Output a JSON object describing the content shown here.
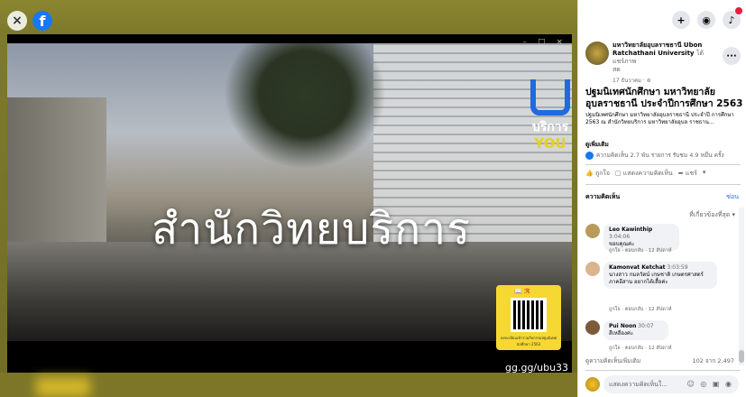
{
  "viewer": {
    "close_glyph": "×",
    "fb_glyph": "f",
    "window_controls": [
      "–",
      "□",
      "×"
    ],
    "caption": "สำนักวิทยบริการ",
    "brand": {
      "t1": "บริการ",
      "t2": "YOU"
    },
    "qr": {
      "tag": "📖 ℛ",
      "small_text": "ลงทะเบียนเข้าร่วมกิจกรรมปฐมนิเทศนักศึกษา 2563"
    },
    "short_url": "gg.gg/ubu33"
  },
  "topbar": {
    "plus_icon": "+",
    "messenger_icon": "◉",
    "bell_icon": "♪"
  },
  "post": {
    "author": "มหาวิทยาลัยอุบลราชธานี Ubon Ratchathani University",
    "with": "ได้แชร์ภาพ",
    "with2": "สด",
    "date": "17 ธันวาคม · ⊚",
    "more": "···",
    "title": "ปฐมนิเทศนักศึกษา มหาวิทยาลัย อุบลราชธานี ประจำปีการศึกษา 2563",
    "body": "ปฐมนิเทศนักศึกษา มหาวิทยาลัยอุบลราชธานี ประจำปี การศึกษา 2563 ณ สำนักวิทยบริการ มหาวิทยาลัยอุบล ราชธาน...",
    "see_more": "ดูเพิ่มเติม",
    "stats": "ความคิดเห็น 2.7 พัน รายการ รับชม 4.9 หมื่น ครั้ง",
    "actions": {
      "like": "ถูกใจ",
      "comment": "แสดงความคิดเห็น",
      "share": "แชร์"
    }
  },
  "comments": {
    "header": "ความคิดเห็น",
    "hide": "ซ่อน",
    "sort": "ที่เกี่ยวข้องที่สุด ▾",
    "items": [
      {
        "name": "Leo Kawinthip",
        "time": "3:04:06",
        "text": "ขอบคุณค่ะ",
        "meta": "ถูกใจ · ตอบกลับ · 12 สัปดาห์"
      },
      {
        "name": "Kamonvat Ketchat",
        "time": "3:03:59",
        "text": "นางสาว กมลวัตน์ เกษชาติ เกษตรศาสตร์ ภาคอีสาน อยากได้เสื้อค่ะ",
        "meta": "ถูกใจ · ตอบกลับ · 12 สัปดาห์"
      },
      {
        "name": "Pui Noon",
        "time": "30:07",
        "text": "สีเหลืองค่ะ",
        "meta": "ถูกใจ · ตอบกลับ · 12 สัปดาห์"
      }
    ],
    "more_label": "ดูความคิดเห็นเพิ่มเติม",
    "count": "102 จาก 2,497"
  },
  "composer": {
    "placeholder": "แสดงความคิดเห็นใ...",
    "emoji_icons": "☺ ◎ ▣ ◉"
  },
  "colors": {
    "accent": "#1877f2",
    "bg": "#6f6a22"
  }
}
